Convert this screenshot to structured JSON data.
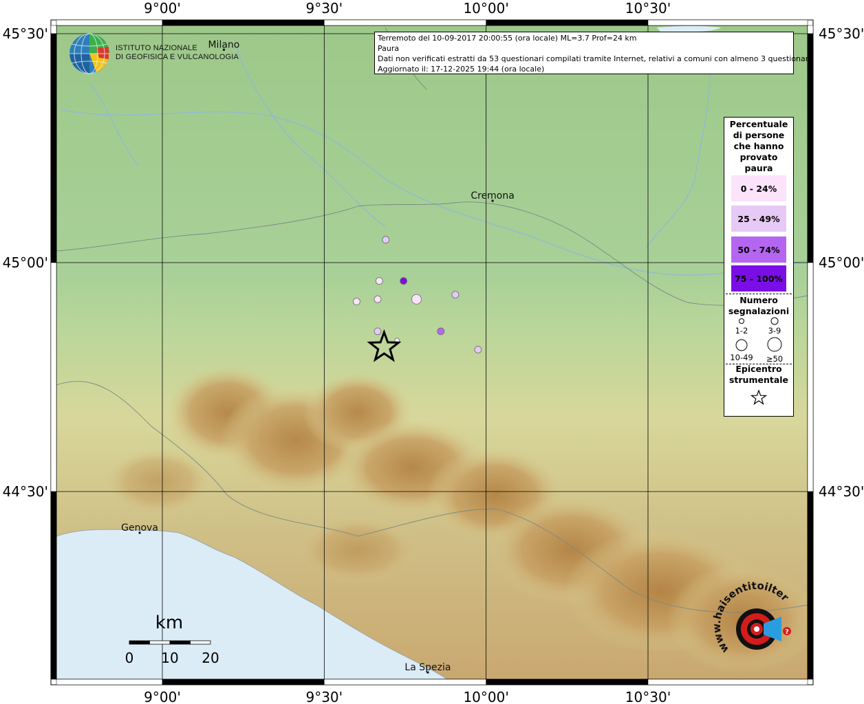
{
  "info": {
    "line1": "Terremoto del 10-09-2017 20:00:55 (ora locale) ML=3.7 Prof=24 km",
    "line2": "Paura",
    "line3": "Dati non verificati estratti da 53 questionari compilati tramite Internet, relativi a comuni con almeno 3 questionari.",
    "line4": "Aggiornato il: 17-12-2025 19:44 (ora locale)"
  },
  "institute": {
    "line1": "ISTITUTO NAZIONALE",
    "line2": "DI GEOFISICA E VULCANOLOGIA"
  },
  "axes": {
    "lon_ticks": [
      "9°00'",
      "9°30'",
      "10°00'",
      "10°30'"
    ],
    "lat_ticks": [
      "45°30'",
      "45°00'",
      "44°30'"
    ],
    "lon_range": [
      8.8,
      11.0
    ],
    "lat_range": [
      44.13,
      45.52
    ]
  },
  "cities": [
    {
      "name": "Milano",
      "lon": 9.19,
      "lat": 45.465
    },
    {
      "name": "Cremona",
      "lon": 10.02,
      "lat": 45.135
    },
    {
      "name": "Genova",
      "lon": 8.93,
      "lat": 44.41
    },
    {
      "name": "La Spezia",
      "lon": 9.82,
      "lat": 44.105
    }
  ],
  "epicenter": {
    "lon": 9.685,
    "lat": 44.815
  },
  "reports": [
    {
      "lon": 9.69,
      "lat": 45.05,
      "class": 1,
      "size": 2
    },
    {
      "lon": 9.67,
      "lat": 44.96,
      "class": 0,
      "size": 2
    },
    {
      "lon": 9.745,
      "lat": 44.96,
      "class": 3,
      "size": 2
    },
    {
      "lon": 9.6,
      "lat": 44.915,
      "class": 0,
      "size": 2
    },
    {
      "lon": 9.665,
      "lat": 44.92,
      "class": 0,
      "size": 2
    },
    {
      "lon": 9.785,
      "lat": 44.92,
      "class": 0,
      "size": 3
    },
    {
      "lon": 9.905,
      "lat": 44.93,
      "class": 1,
      "size": 2
    },
    {
      "lon": 9.665,
      "lat": 44.85,
      "class": 1,
      "size": 2
    },
    {
      "lon": 9.725,
      "lat": 44.83,
      "class": 0,
      "size": 1
    },
    {
      "lon": 9.86,
      "lat": 44.85,
      "class": 2,
      "size": 2
    },
    {
      "lon": 9.975,
      "lat": 44.81,
      "class": 1,
      "size": 2
    }
  ],
  "legend": {
    "title": [
      "Percentuale",
      "di persone",
      "che hanno",
      "provato",
      "paura"
    ],
    "classes": [
      {
        "label": "0 - 24%",
        "color": "#fbe3fb"
      },
      {
        "label": "25 - 49%",
        "color": "#e6c9f5"
      },
      {
        "label": "50 - 74%",
        "color": "#b566f0"
      },
      {
        "label": "75 - 100%",
        "color": "#7b0ee6"
      }
    ],
    "size_title": [
      "Numero",
      "segnalazioni"
    ],
    "sizes": [
      "1-2",
      "3-9",
      "10-49",
      "≥50"
    ],
    "epi_title": [
      "Epicentro",
      "strumentale"
    ]
  },
  "scale": {
    "title": "km",
    "ticks": [
      "0",
      "10",
      "20"
    ]
  },
  "badge": {
    "text": "haisentitoilterremoto.it",
    "prefix": "www."
  },
  "colors": {
    "sea": "#dcecf6",
    "frame": "#000000",
    "grid": "#000000"
  }
}
